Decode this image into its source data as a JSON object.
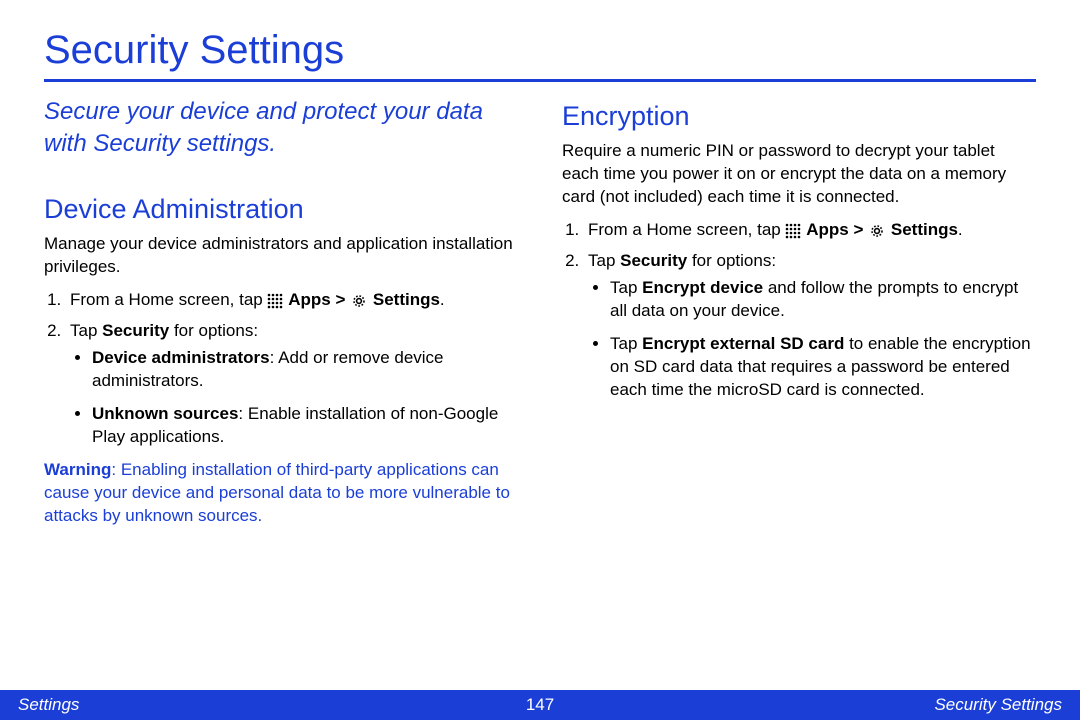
{
  "title": "Security Settings",
  "intro": "Secure your device and protect your data with Security settings.",
  "nav": {
    "apps": "Apps",
    "gt": ">",
    "settings": "Settings"
  },
  "step_home_prefix": "From a Home screen, tap",
  "step_home_suffix": ".",
  "step_security_prefix": "Tap ",
  "step_security_bold": "Security",
  "step_security_suffix": " for options:",
  "device_admin": {
    "heading": "Device Administration",
    "desc": "Manage your device administrators and application installation privileges.",
    "b1_bold": "Device administrators",
    "b1_rest": ": Add or remove device administrators.",
    "b2_bold": "Unknown sources",
    "b2_rest": ": Enable installation of non-Google Play applications.",
    "warn_bold": "Warning",
    "warn_rest": ": Enabling installation of third-party applications can cause your device and personal data to be more vulnerable to attacks by unknown sources."
  },
  "encryption": {
    "heading": "Encryption",
    "desc": "Require a numeric PIN or password to decrypt your tablet each time you power it on or encrypt the data on a memory card (not included) each time it is connected.",
    "b1_prefix": "Tap ",
    "b1_bold": "Encrypt device",
    "b1_rest": " and follow the prompts to encrypt all data on your device.",
    "b2_prefix": "Tap ",
    "b2_bold": "Encrypt external SD card",
    "b2_rest": " to enable the encryption on SD card data that requires a password be entered each time the microSD card is connected."
  },
  "footer": {
    "left": "Settings",
    "page": "147",
    "right": "Security Settings"
  }
}
